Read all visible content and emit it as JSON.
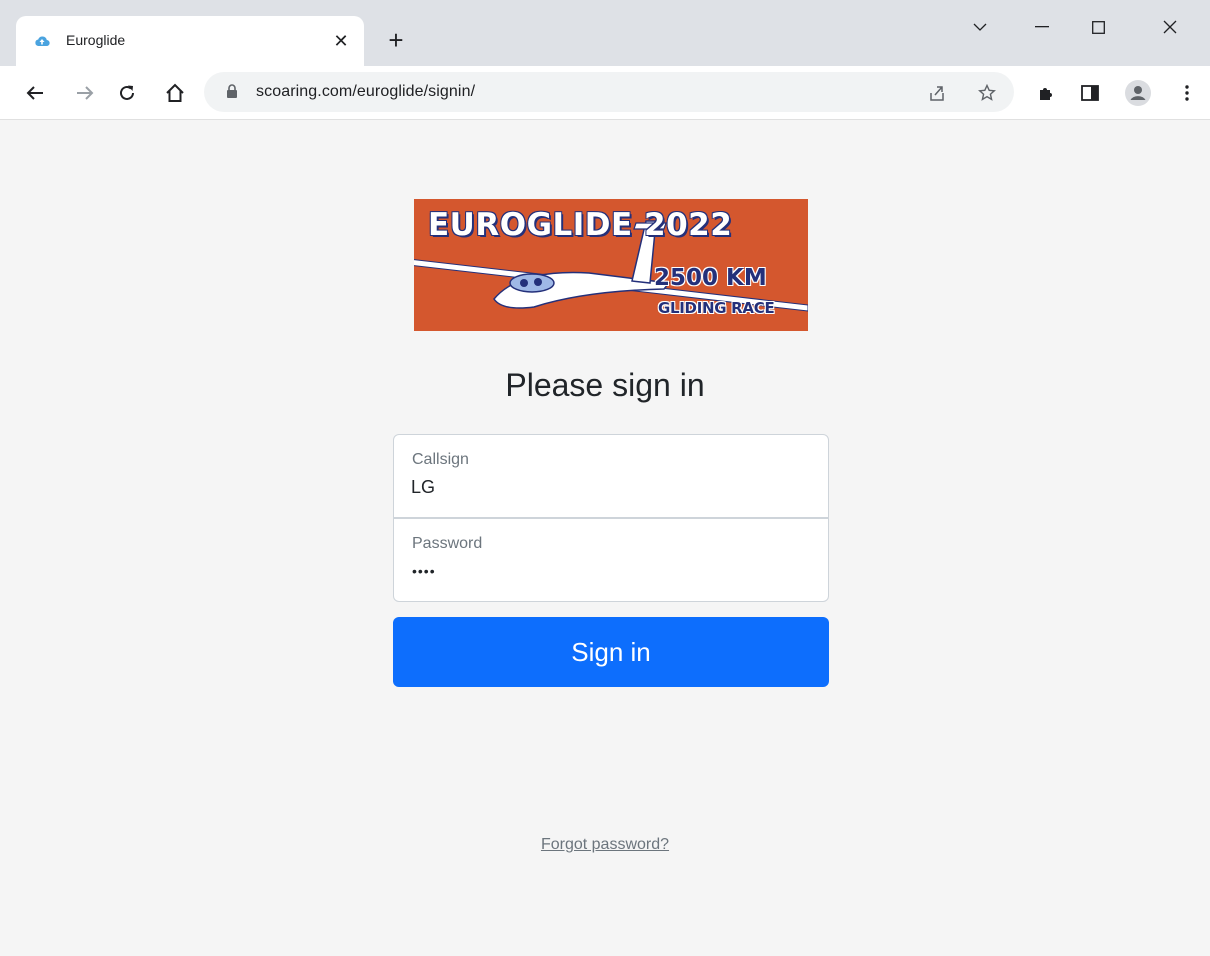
{
  "browser": {
    "tab": {
      "title": "Euroglide",
      "favicon": "cloud-icon"
    },
    "address_bar": {
      "url": "scoaring.com/euroglide/signin/"
    },
    "colors": {
      "tabstrip": "#dee1e6",
      "toolbar": "#ffffff",
      "omnibox": "#f1f3f4"
    }
  },
  "logo": {
    "line1": "EUROGLIDE 2022",
    "line2": "2500 KM",
    "line3": "GLIDING RACE",
    "background": "#d4572e",
    "accent": "#24307a"
  },
  "signin": {
    "heading": "Please sign in",
    "callsign": {
      "label": "Callsign",
      "value": "LG"
    },
    "password": {
      "label": "Password",
      "value": "••••"
    },
    "submit_label": "Sign in",
    "forgot_label": "Forgot password?"
  },
  "colors": {
    "primary": "#0d6efd",
    "page_bg": "#f5f5f5",
    "muted_text": "#6c757d"
  }
}
